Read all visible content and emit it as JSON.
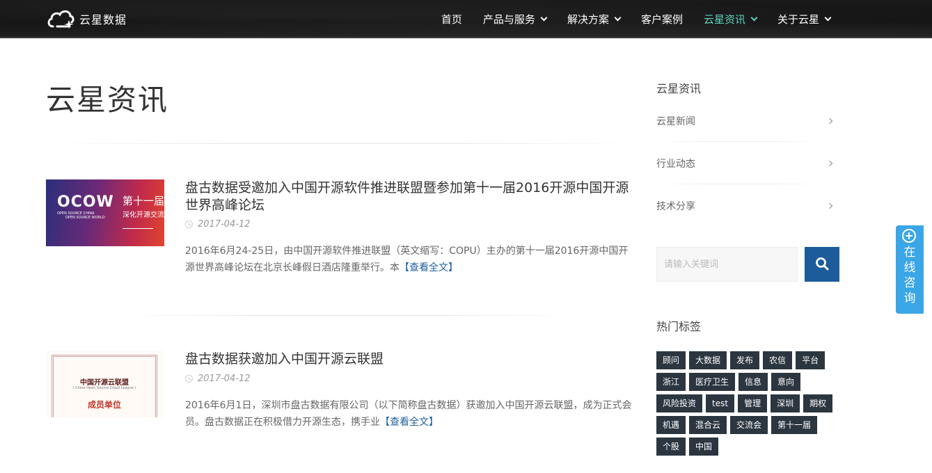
{
  "header": {
    "logo_text": "云星数据",
    "nav": [
      {
        "label": "首页",
        "dropdown": false,
        "active": false
      },
      {
        "label": "产品与服务",
        "dropdown": true,
        "active": false
      },
      {
        "label": "解决方案",
        "dropdown": true,
        "active": false
      },
      {
        "label": "客户案例",
        "dropdown": false,
        "active": false
      },
      {
        "label": "云星资讯",
        "dropdown": true,
        "active": true
      },
      {
        "label": "关于云星",
        "dropdown": true,
        "active": false
      }
    ],
    "active_color": "#5fd6c0"
  },
  "main": {
    "page_title": "云星资讯",
    "posts": [
      {
        "title": "盘古数据受邀加入中国开源软件推进联盟暨参加第十一届2016开源中国开源世界高峰论坛",
        "date": "2017-04-12",
        "excerpt": "2016年6月24-25日，由中国开源软件推进联盟（英文缩写：COPU）主办的第十一届2016开源中国开源世界高峰论坛在北京长峰假日酒店隆重举行。本",
        "read_more": "【查看全文】",
        "thumb": {
          "brand": "OCOW",
          "line1": "OPEN SOURCE CHINA",
          "line2": "OPEN SOURCE WORLD",
          "cn1": "第十一届",
          "cn2": "深化开源交流"
        }
      },
      {
        "title": "盘古数据获邀加入中国开源云联盟",
        "date": "2017-04-12",
        "excerpt": "2016年6月1日，深圳市盘古数据有限公司（以下简称盘古数据）获邀加入中国开源云联盟，成为正式会员。盘古数据正在积极借力开源生态，携手业",
        "read_more": "【查看全文】",
        "thumb": {
          "cn1": "中国开源云联盟",
          "en": "( China Open Source Cloud League )",
          "cn2": "成员单位"
        }
      }
    ]
  },
  "sidebar": {
    "heading": "云星资讯",
    "items": [
      {
        "label": "云星新闻"
      },
      {
        "label": "行业动态"
      },
      {
        "label": "技术分享"
      }
    ],
    "search": {
      "placeholder": "请输入关键词",
      "value": ""
    },
    "tags_heading": "热门标签",
    "tags": [
      "顾问",
      "大数据",
      "发布",
      "农信",
      "平台",
      "浙江",
      "医疗卫生",
      "信息",
      "意向",
      "风险投资",
      "test",
      "管理",
      "深圳",
      "期权",
      "机遇",
      "混合云",
      "交流会",
      "第十一届",
      "个股",
      "中国"
    ],
    "accent_color": "#1c5c9b"
  },
  "consult": {
    "label": "在线咨询",
    "color": "#3aa6e6"
  }
}
